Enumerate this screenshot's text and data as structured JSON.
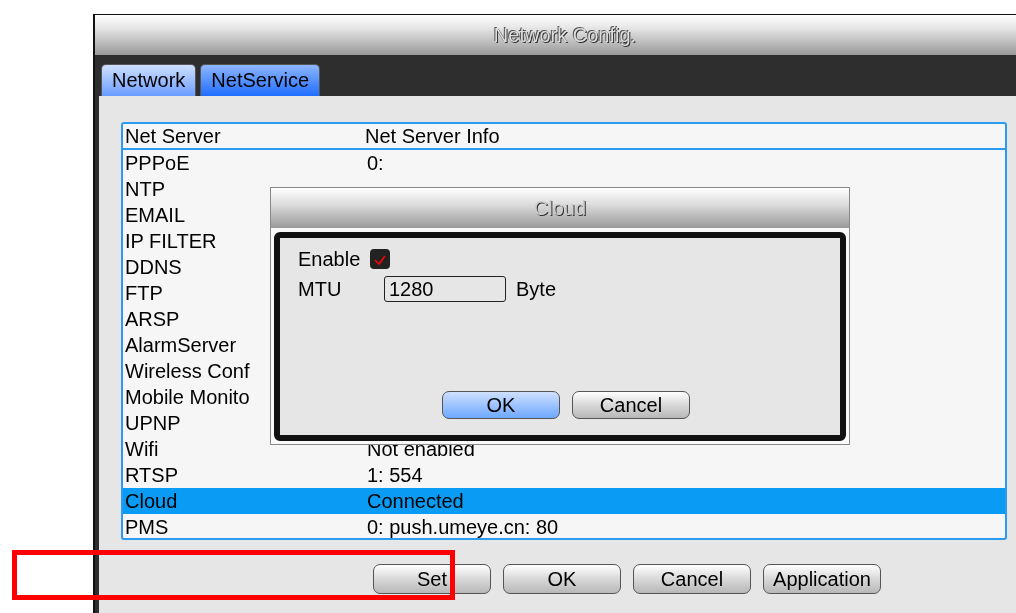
{
  "window": {
    "title": "Network Config."
  },
  "tabs": [
    {
      "label": "Network",
      "selected": false
    },
    {
      "label": "NetService",
      "selected": true
    }
  ],
  "table": {
    "columns": [
      "Net Server",
      "Net Server Info"
    ],
    "rows": [
      {
        "name": "PPPoE",
        "info": "0:",
        "selected": false
      },
      {
        "name": "NTP",
        "selected": false
      },
      {
        "name": "EMAIL",
        "selected": false
      },
      {
        "name": "IP FILTER",
        "selected": false
      },
      {
        "name": "DDNS",
        "selected": false
      },
      {
        "name": "FTP",
        "selected": false
      },
      {
        "name": "ARSP",
        "selected": false
      },
      {
        "name": "AlarmServer",
        "selected": false
      },
      {
        "name": "Wireless Conf",
        "selected": false
      },
      {
        "name": "Mobile Monito",
        "selected": false
      },
      {
        "name": "UPNP",
        "selected": false
      },
      {
        "name": "Wifi",
        "info": "Not enabled",
        "selected": false
      },
      {
        "name": "RTSP",
        "info": "1: 554",
        "selected": false
      },
      {
        "name": "Cloud",
        "info": "Connected",
        "selected": true
      },
      {
        "name": "PMS",
        "info": "0: push.umeye.cn: 80",
        "selected": false
      }
    ]
  },
  "buttons": [
    "Set",
    "OK",
    "Cancel",
    "Application"
  ],
  "dialog": {
    "title": "Cloud",
    "enable": {
      "label": "Enable",
      "checked": true
    },
    "mtu": {
      "label": "MTU",
      "value": "1280",
      "unit": "Byte"
    },
    "buttons": [
      {
        "label": "OK",
        "kind": "default"
      },
      {
        "label": "Cancel",
        "kind": "normal"
      }
    ]
  }
}
